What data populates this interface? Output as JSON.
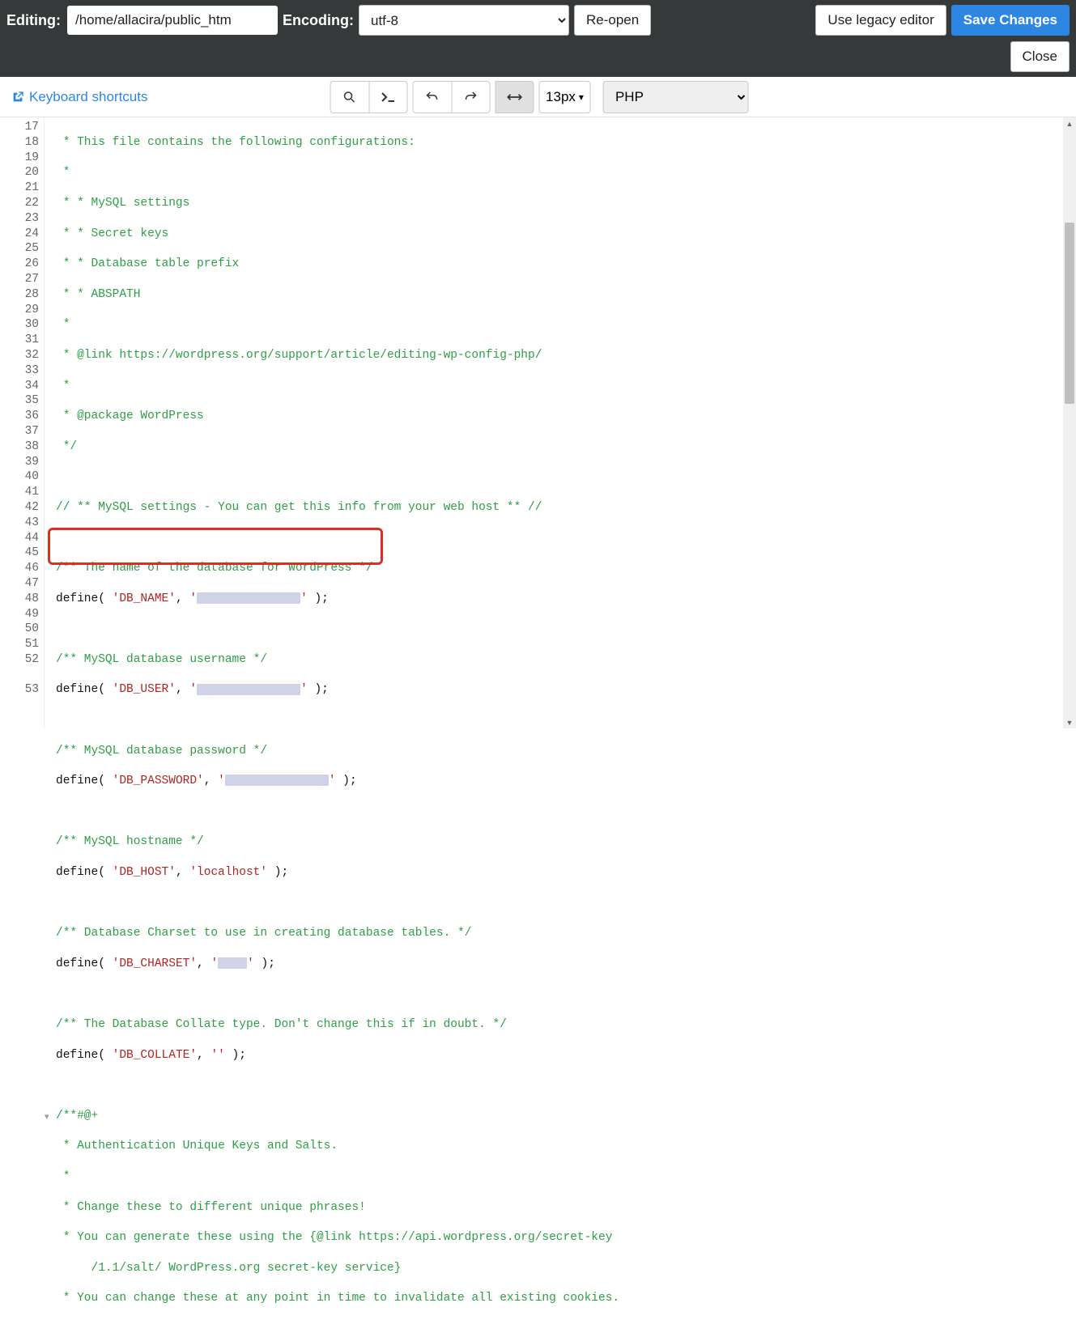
{
  "topbar": {
    "editing_label": "Editing:",
    "path_value": "/home/allacira/public_htm",
    "encoding_label": "Encoding:",
    "encoding_value": "utf-8",
    "reopen_label": "Re-open",
    "legacy_label": "Use legacy editor",
    "save_label": "Save Changes",
    "close_label": "Close"
  },
  "toolbar": {
    "kbd_link": "Keyboard shortcuts",
    "font_size": "13px",
    "language": "PHP"
  },
  "gutter": {
    "start": 17,
    "end": 53
  },
  "code": {
    "l17": " * This file contains the following configurations:",
    "l18": " *",
    "l19": " * * MySQL settings",
    "l20": " * * Secret keys",
    "l21": " * * Database table prefix",
    "l22": " * * ABSPATH",
    "l23": " *",
    "l24": " * @link https://wordpress.org/support/article/editing-wp-config-php/",
    "l25": " *",
    "l26": " * @package WordPress",
    "l27": " */",
    "l29": "// ** MySQL settings - You can get this info from your web host ** //",
    "l30": "/** The name of the database for WordPress */",
    "l31a": "define( ",
    "l31b": "'DB_NAME'",
    "l31c": ", ",
    "l31d": "'",
    "l31f": "'",
    "l31g": " );",
    "l33": "/** MySQL database username */",
    "l34a": "define( ",
    "l34b": "'DB_USER'",
    "l36": "/** MySQL database password */",
    "l37b": "'DB_PASSWORD'",
    "l39": "/** MySQL hostname */",
    "l40a": "define( ",
    "l40b": "'DB_HOST'",
    "l40c": ", ",
    "l40d": "'localhost'",
    "l40e": " );",
    "l42": "/** Database Charset to use in creating database tables. */",
    "l43b": "'DB_CHARSET'",
    "l45": "/** The Database Collate type. Don't change this if in doubt. */",
    "l46a": "define( ",
    "l46b": "'DB_COLLATE'",
    "l46c": ", ",
    "l46d": "''",
    "l46e": " );",
    "l48": "/**#@+",
    "l49": " * Authentication Unique Keys and Salts.",
    "l50": " *",
    "l51": " * Change these to different unique phrases!",
    "l52a": " * You can generate these using the {@link https://api.wordpress.org/secret-key",
    "l52b": "     /1.1/salt/ WordPress.org secret-key service}",
    "l53": " * You can change these at any point in time to invalidate all existing cookies."
  }
}
